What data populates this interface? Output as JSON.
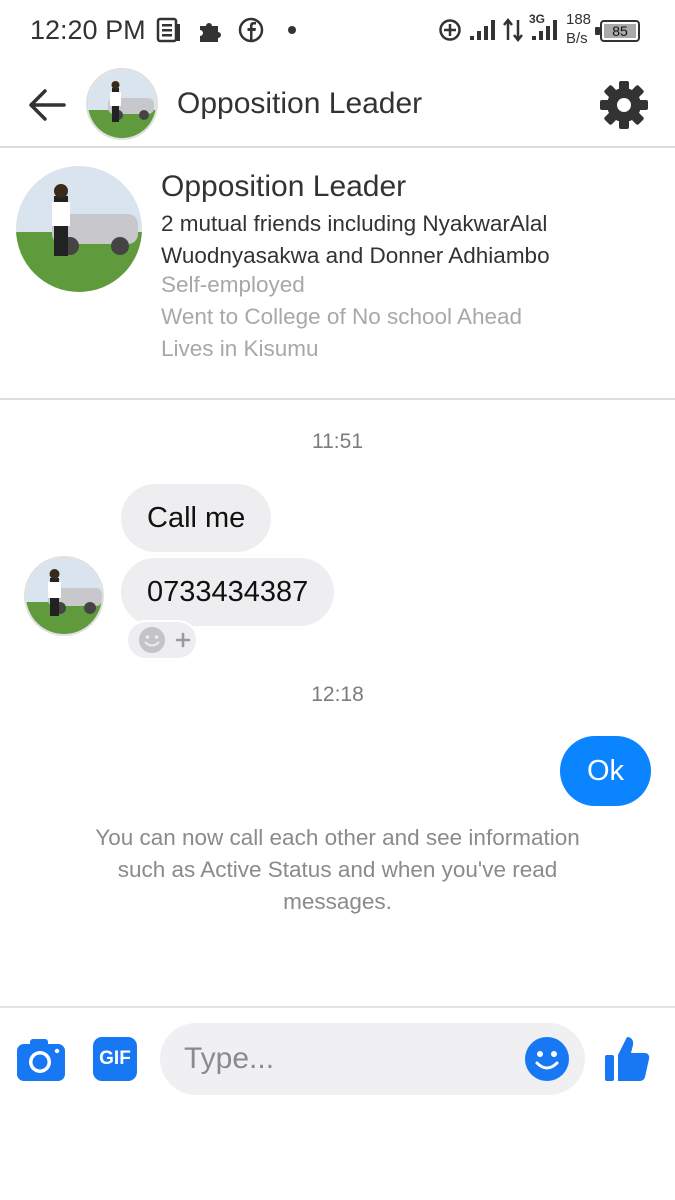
{
  "status_bar": {
    "time": "12:20 PM",
    "network_type": "3G",
    "speed_value": "188",
    "speed_unit": "B/s",
    "battery": "85"
  },
  "header": {
    "title": "Opposition Leader"
  },
  "profile": {
    "name": "Opposition Leader",
    "mutual": "2 mutual friends including NyakwarAlal Wuodnyasakwa and Donner Adhiambo",
    "work": "Self-employed",
    "education": "Went to College of No school Ahead",
    "lives": "Lives in Kisumu"
  },
  "conversation": {
    "timestamp_1": "11:51",
    "incoming": [
      "Call me",
      "0733434387"
    ],
    "timestamp_2": "12:18",
    "outgoing": [
      "Ok"
    ],
    "info": "You can now call each other and see information such as Active Status and when you've read messages."
  },
  "composer": {
    "gif_label": "GIF",
    "placeholder": "Type..."
  },
  "colors": {
    "accent": "#0b84ff",
    "icon_blue": "#1877f2",
    "bubble_gray": "#eeeef0",
    "muted_text": "#a7a7ad"
  },
  "icons": {
    "back": "arrow-left-icon",
    "settings": "gear-icon",
    "camera": "camera-icon",
    "gif": "gif-icon",
    "emoji": "emoji-icon",
    "like": "thumbs-up-icon",
    "reaction": "add-reaction-icon"
  }
}
